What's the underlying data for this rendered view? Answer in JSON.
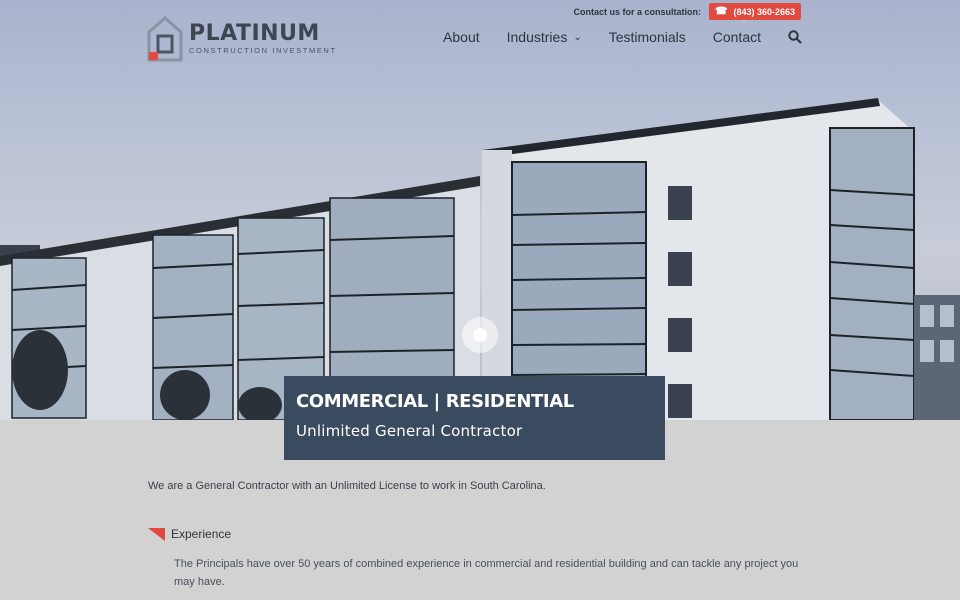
{
  "header": {
    "logo_name": "PLATINUM",
    "logo_sub": "CONSTRUCTION INVESTMENT",
    "contact_prompt": "Contact us for a consultation:",
    "phone": "(843) 360-2663",
    "nav": {
      "about": "About",
      "industries": "Industries",
      "testimonials": "Testimonials",
      "contact": "Contact"
    }
  },
  "hero": {
    "title": "COMMERCIAL | RESIDENTIAL",
    "subtitle": "Unlimited General Contractor"
  },
  "content": {
    "intro": "We are a General Contractor with an Unlimited License to work in South Carolina.",
    "section_title": "Experience",
    "section_text": "The Principals have over 50 years of combined experience in commercial and residential building and can tackle any project you may have."
  },
  "colors": {
    "accent": "#e2493f",
    "caption_bg": "#3a4a5f",
    "page_bg": "#d2d2d2"
  },
  "icons": [
    "logo-house-icon",
    "phone-icon",
    "chevron-down-icon",
    "search-icon",
    "flag-icon"
  ]
}
